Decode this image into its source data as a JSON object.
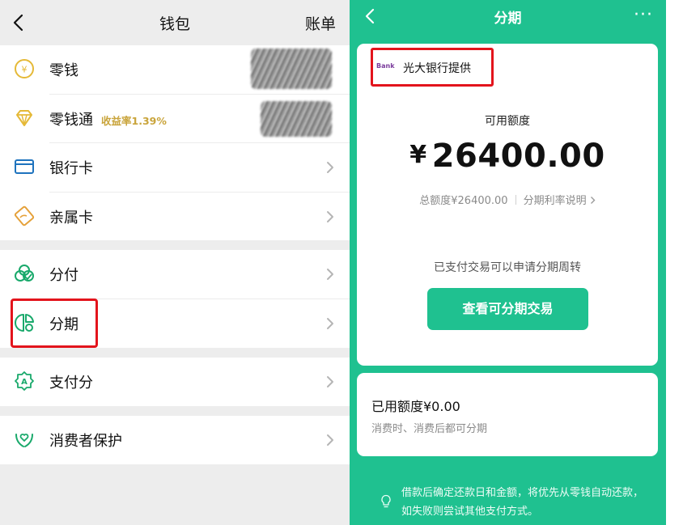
{
  "wallet": {
    "title": "钱包",
    "bill_label": "账单",
    "items": [
      {
        "label": "零钱",
        "icon": "coin-icon"
      },
      {
        "label": "零钱通",
        "sub": "收益率1.39%",
        "icon": "diamond-icon"
      },
      {
        "label": "银行卡",
        "icon": "bank-card-icon"
      },
      {
        "label": "亲属卡",
        "icon": "family-card-icon"
      },
      {
        "label": "分付",
        "icon": "split-pay-icon"
      },
      {
        "label": "分期",
        "icon": "installment-icon"
      },
      {
        "label": "支付分",
        "icon": "pay-score-icon"
      },
      {
        "label": "消费者保护",
        "icon": "consumer-protection-icon"
      }
    ]
  },
  "installment": {
    "title": "分期",
    "more_label": "···",
    "bank_logo_text": "Bank",
    "bank_provider": "光大银行提供",
    "available_label": "可用额度",
    "currency": "¥",
    "available_amount": "26400.00",
    "total_quota": "总额度¥26400.00",
    "rate_link": "分期利率说明",
    "apply_text": "已支付交易可以申请分期周转",
    "view_button": "查看可分期交易",
    "used_label": "已用额度¥0.00",
    "used_sub": "消费时、消费后都可分期",
    "tip": "借款后确定还款日和金额，将优先从零钱自动还款，如失败则尝试其他支付方式。"
  },
  "colors": {
    "accent": "#1fc190",
    "highlight": "#e3141c",
    "gold": "#c9a43b",
    "icon_blue": "#1e73be",
    "icon_green": "#19a96b"
  }
}
